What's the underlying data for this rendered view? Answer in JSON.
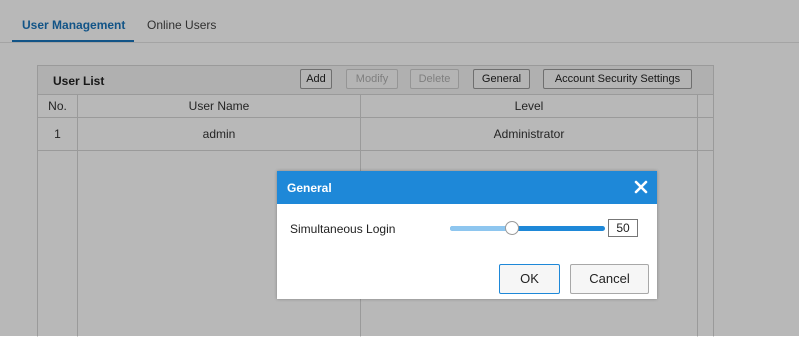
{
  "tabs": {
    "user_management": "User Management",
    "online_users": "Online Users"
  },
  "user_list": {
    "title": "User List",
    "buttons": {
      "add": "Add",
      "modify": "Modify",
      "delete": "Delete",
      "general": "General",
      "account_security": "Account Security Settings"
    },
    "columns": {
      "no": "No.",
      "user_name": "User Name",
      "level": "Level"
    },
    "rows": [
      {
        "no": "1",
        "user_name": "admin",
        "level": "Administrator"
      }
    ]
  },
  "dialog": {
    "title": "General",
    "field_label": "Simultaneous Login",
    "value": "50",
    "slider_fraction": 0.4,
    "ok_label": "OK",
    "cancel_label": "Cancel"
  },
  "colors": {
    "accent": "#1e88d8",
    "tab_active": "#1a75bb",
    "slider_fill": "#8ec6ef"
  },
  "icons": {
    "close": "close-icon"
  }
}
